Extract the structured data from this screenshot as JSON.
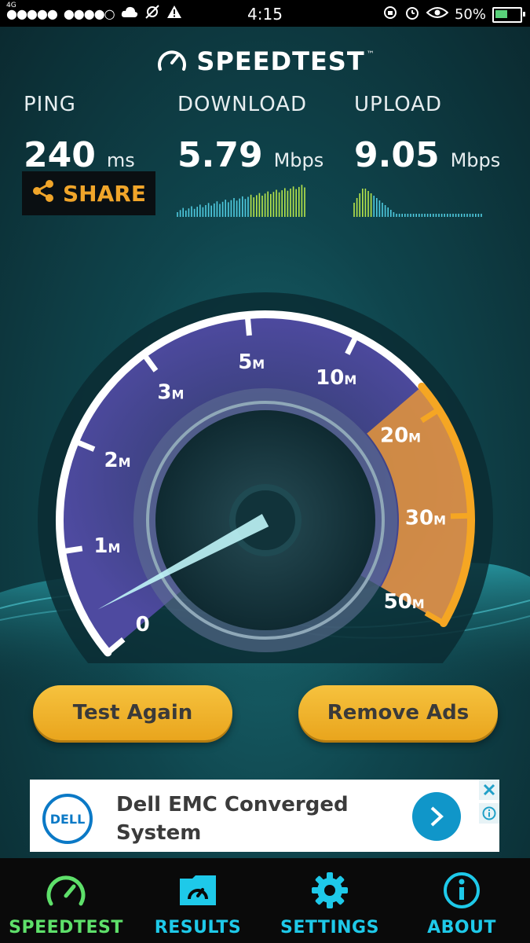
{
  "status_bar": {
    "network": "4G",
    "signal1": "●●●●●",
    "signal2": "●●●●○",
    "time": "4:15",
    "battery": "50%",
    "battery_level": 0.5
  },
  "app": {
    "logo_text": "SPEEDTEST",
    "trademark": "™"
  },
  "metrics": {
    "ping": {
      "label": "PING",
      "value": "240",
      "unit": "ms"
    },
    "download": {
      "label": "DOWNLOAD",
      "value": "5.79",
      "unit": "Mbps"
    },
    "upload": {
      "label": "UPLOAD",
      "value": "9.05",
      "unit": "Mbps"
    }
  },
  "share_label": "SHARE",
  "gauge": {
    "ticks": [
      "0",
      "1",
      "2",
      "3",
      "5",
      "10",
      "20",
      "30",
      "50"
    ],
    "unit_suffix": "M",
    "needle_value": "0",
    "accent_color": "#f5a623",
    "arc_color": "#ffffff"
  },
  "buttons": {
    "test_again": "Test Again",
    "remove_ads": "Remove Ads"
  },
  "ad": {
    "brand": "DELL",
    "line1": "Dell EMC Converged",
    "line2": "System"
  },
  "tabs": [
    {
      "label": "SPEEDTEST",
      "icon": "speedometer-icon",
      "active": true
    },
    {
      "label": "RESULTS",
      "icon": "folder-speed-icon",
      "active": false
    },
    {
      "label": "SETTINGS",
      "icon": "gear-icon",
      "active": false
    },
    {
      "label": "ABOUT",
      "icon": "info-icon",
      "active": false
    }
  ],
  "colors": {
    "accent": "#f0a52a",
    "tab_active": "#5ee06a",
    "tab_inactive": "#1ec9e9"
  }
}
